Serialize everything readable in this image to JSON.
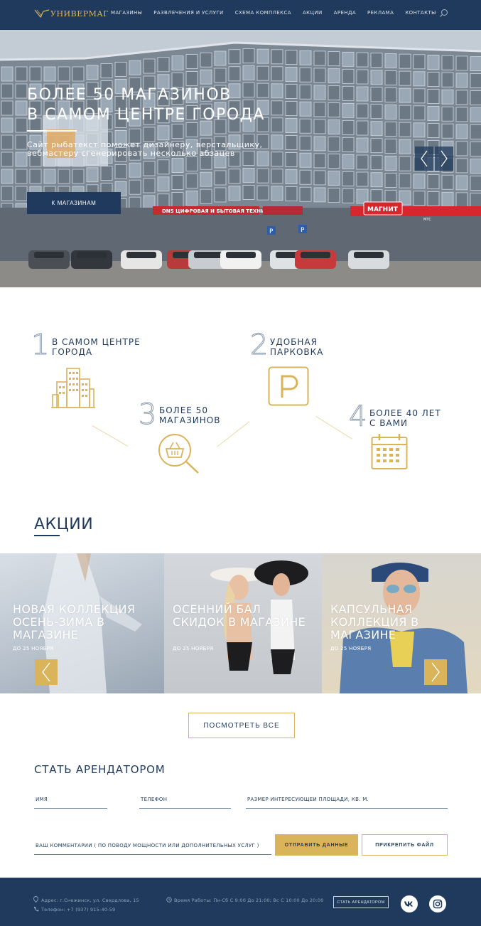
{
  "header": {
    "logo": "УНИВЕРМАГ",
    "nav": [
      "МАГАЗИНЫ",
      "РАЗВЛЕЧЕНИЯ И УСЛУГИ",
      "СХЕМА КОМПЛЕКСА",
      "АКЦИИ",
      "АРЕНДА",
      "РЕКЛАМА",
      "КОНТАКТЫ"
    ],
    "search_icon": "search-icon"
  },
  "hero": {
    "title_line1": "БОЛЕЕ 50 МАГАЗИНОВ",
    "title_line2": "В САМОМ ЦЕНТРЕ ГОРОДА",
    "subtitle": "Сайт рыбатекст поможет дизайнеру, верстальщику, вебмастеру сгенерировать несколько абзацев",
    "button": "К МАГАЗИНАМ",
    "signs": {
      "dns": "DNS ЦИФРОВАЯ И БЫТОВАЯ ТЕХНИКА",
      "magnit": "МАГНИТ",
      "mts": "МТС",
      "parking": "P"
    }
  },
  "features": [
    {
      "num": "1",
      "label_line1": "В САМОМ ЦЕНТРЕ",
      "label_line2": "ГОРОДА",
      "icon": "buildings-icon"
    },
    {
      "num": "2",
      "label_line1": "УДОБНАЯ",
      "label_line2": "ПАРКОВКА",
      "icon": "parking-icon"
    },
    {
      "num": "3",
      "label_line1": "БОЛЕЕ 50",
      "label_line2": "МАГАЗИНОВ",
      "icon": "shopping-basket-search-icon"
    },
    {
      "num": "4",
      "label_line1": "БОЛЕЕ 40 ЛЕТ",
      "label_line2": "С ВАМИ",
      "icon": "calendar-icon"
    }
  ],
  "promos": {
    "title": "АКЦИИ",
    "items": [
      {
        "title": "НОВАЯ КОЛЛЕКЦИЯ ОСЕНЬ-ЗИМА В МАГАЗИНЕ",
        "date": "ДО 25 НОЯБРЯ"
      },
      {
        "title": "ОСЕННИЙ БАЛ СКИДОК В МАГАЗИНЕ",
        "date": "ДО 25 НОЯБРЯ"
      },
      {
        "title": "КАПСУЛЬНАЯ КОЛЛЕКЦИЯ В МАГАЗИНЕ",
        "date": "ДО 25 НОЯБРЯ"
      }
    ],
    "view_all": "ПОСМОТРЕТЬ ВСЕ"
  },
  "form": {
    "title": "СТАТЬ АРЕНДАТОРОМ",
    "name_placeholder": "ИМЯ",
    "phone_placeholder": "ТЕЛЕФОН",
    "area_placeholder": "РАЗМЕР ИНТЕРЕСУЮЩЕЙ ПЛОЩАДИ, КВ. М.",
    "comment_placeholder": "ВАШ КОММЕНТАРИЙ ( ПО ПОВОДУ МОЩНОСТИ ИЛИ ДОПОЛНИТЕЛЬНЫХ УСЛУГ )",
    "send": "ОТПРАВИТЬ ДАННЫЕ",
    "attach": "ПРИКРЕПИТЬ ФАЙЛ"
  },
  "footer": {
    "address": "Адрес: г.Снежинск, ул. Свердлова, 15",
    "phone": "Телефон: +7 (937) 915-40-59",
    "hours": "Время Работы: Пн-Сб С 9:00 До 21:00;  Вс  С 10:00 До 20:00",
    "tenant_button": "СТАТЬ АРЕНДАТОРОМ",
    "social": [
      "vk-icon",
      "instagram-icon"
    ]
  },
  "colors": {
    "navy": "#1f3a5c",
    "gold": "#d9b45a"
  }
}
